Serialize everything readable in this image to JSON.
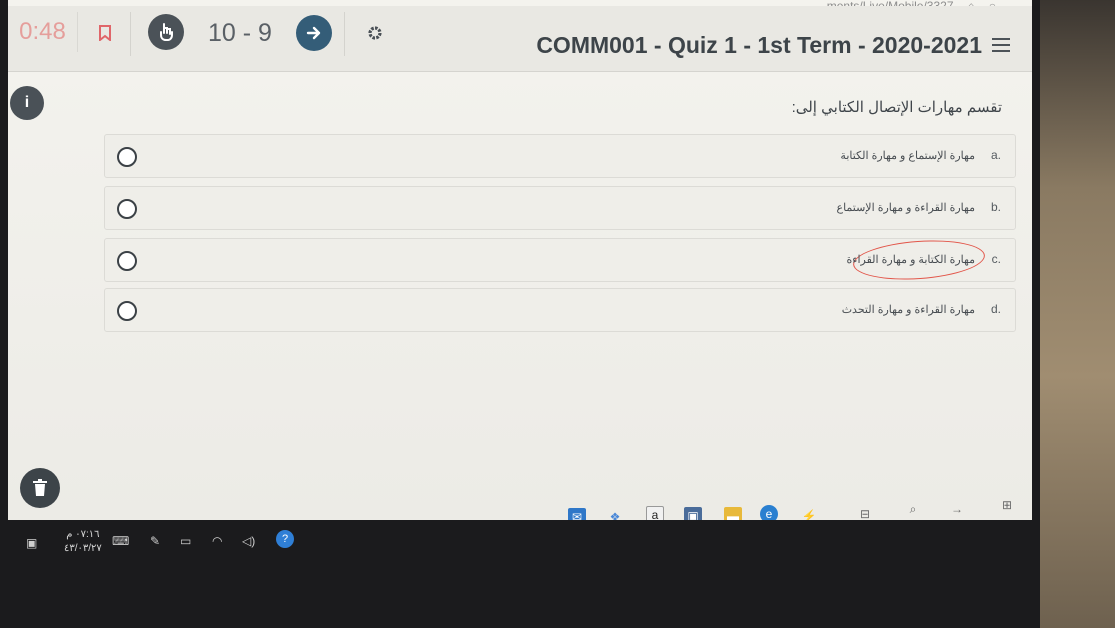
{
  "browser": {
    "url_fragment": "…ments/Live/Mobile/3327"
  },
  "header": {
    "timer": "0:48",
    "question_counter": "10 - 9",
    "quiz_title": "COMM001 - Quiz 1 - 1st Term - 2020-2021"
  },
  "question": {
    "text": "تقسم مهارات الإتصال الكتابي إلى:",
    "options": [
      {
        "letter": "a.",
        "text": "مهارة الإستماع و مهارة الكتابة"
      },
      {
        "letter": "b.",
        "text": "مهارة القراءة و مهارة الإستماع"
      },
      {
        "letter": "c.",
        "text": "مهارة الكتابة و مهارة القراءة"
      },
      {
        "letter": "d.",
        "text": "مهارة القراءة و مهارة التحدث"
      }
    ]
  },
  "taskbar": {
    "clock_time": "٠٧:١٦ م",
    "clock_date": "٤٣/٠٣/٢٧"
  },
  "colors": {
    "timer": "#e59e9b",
    "next_button": "#345d78",
    "handwritten_circle": "#e2564a"
  }
}
